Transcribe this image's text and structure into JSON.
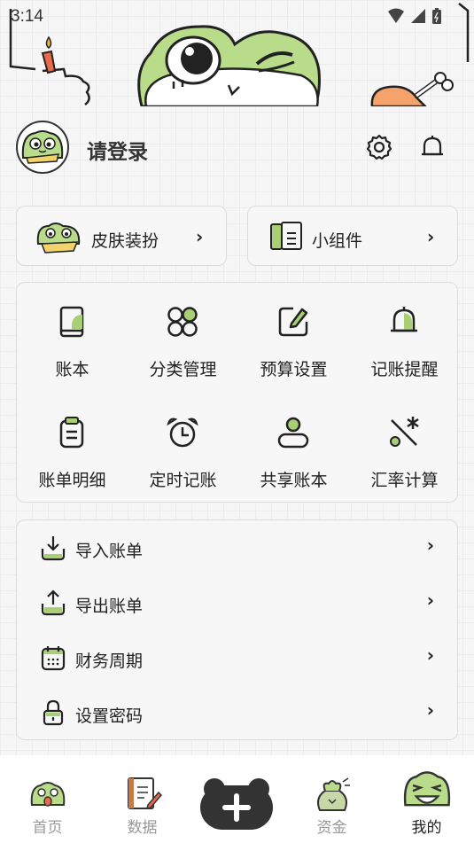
{
  "status_bar": {
    "time": "3:14"
  },
  "header": {
    "login_text": "请登录"
  },
  "quick_cards": [
    {
      "label": "皮肤装扮"
    },
    {
      "label": "小组件"
    }
  ],
  "grid": [
    {
      "label": "账本",
      "icon": "book-icon"
    },
    {
      "label": "分类管理",
      "icon": "category-icon"
    },
    {
      "label": "预算设置",
      "icon": "edit-icon"
    },
    {
      "label": "记账提醒",
      "icon": "bell-icon"
    },
    {
      "label": "账单明细",
      "icon": "clipboard-icon"
    },
    {
      "label": "定时记账",
      "icon": "alarm-clock-icon"
    },
    {
      "label": "共享账本",
      "icon": "user-icon"
    },
    {
      "label": "汇率计算",
      "icon": "exchange-rate-icon"
    }
  ],
  "list": [
    {
      "label": "导入账单",
      "icon": "import-icon"
    },
    {
      "label": "导出账单",
      "icon": "export-icon"
    },
    {
      "label": "财务周期",
      "icon": "calendar-icon"
    },
    {
      "label": "设置密码",
      "icon": "lock-icon"
    }
  ],
  "tabbar": {
    "tabs": [
      {
        "label": "首页",
        "active": false
      },
      {
        "label": "数据",
        "active": false
      },
      {
        "label": "",
        "active": false
      },
      {
        "label": "资金",
        "active": false
      },
      {
        "label": "我的",
        "active": true
      }
    ]
  },
  "colors": {
    "accent_green": "#a8cf74",
    "dark": "#333333",
    "active_tab": "#222222",
    "inactive_tab": "#999999"
  }
}
